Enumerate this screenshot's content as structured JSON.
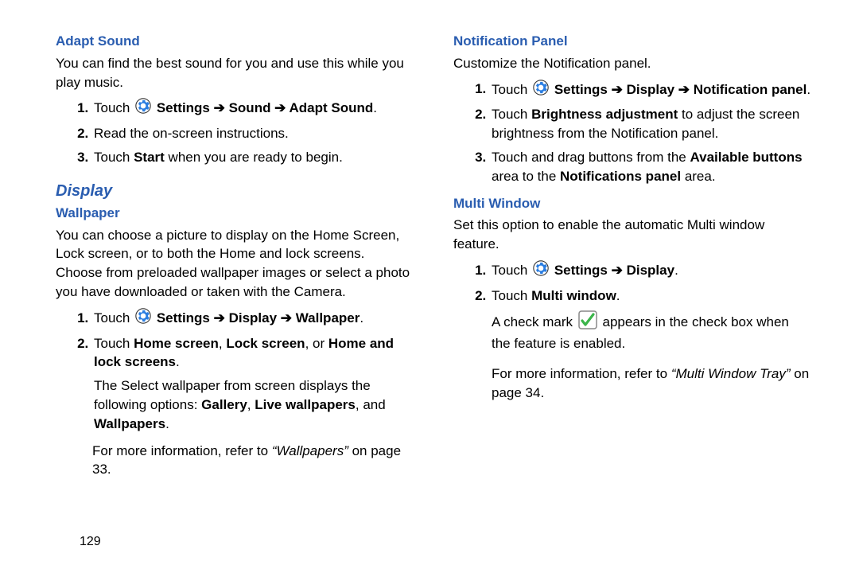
{
  "page_number": "129",
  "left": {
    "adaptSound": {
      "heading": "Adapt Sound",
      "intro": "You can find the best sound for you and use this while you play music.",
      "step1_pre": "Touch ",
      "step1_nav": "Settings ➔ Sound ➔ Adapt Sound",
      "step2": "Read the on-screen instructions.",
      "step3_pre": "Touch ",
      "step3_bold": "Start",
      "step3_post": " when you are ready to begin."
    },
    "displayHeading": "Display",
    "wallpaper": {
      "heading": "Wallpaper",
      "intro": "You can choose a picture to display on the Home Screen, Lock screen, or to both the Home and lock screens. Choose from preloaded wallpaper images or select a photo you have downloaded or taken with the Camera.",
      "step1_pre": "Touch ",
      "step1_nav": "Settings ➔ Display ➔ Wallpaper",
      "step2_pre": "Touch ",
      "step2_b1": "Home screen",
      "step2_m1": ", ",
      "step2_b2": "Lock screen",
      "step2_m2": ", or ",
      "step2_b3": "Home and lock screens",
      "step2_post": ".",
      "step2_follow_pre": "The Select wallpaper from screen displays the following options: ",
      "step2_opt1": "Gallery",
      "step2_comma1": ", ",
      "step2_opt2": "Live wallpapers",
      "step2_comma2": ", and ",
      "step2_opt3": "Wallpapers",
      "step2_follow_post": ".",
      "moreinfo_pre": "For more information, refer to ",
      "moreinfo_ref": "“Wallpapers”",
      "moreinfo_post": " on page 33."
    }
  },
  "right": {
    "notifPanel": {
      "heading": "Notification Panel",
      "intro": "Customize the Notification panel.",
      "step1_pre": "Touch ",
      "step1_nav": "Settings ➔ Display ➔ Notification panel",
      "step2_pre": "Touch ",
      "step2_bold": "Brightness adjustment",
      "step2_post": " to adjust the screen brightness from the Notification panel.",
      "step3_pre": "Touch and drag buttons from the ",
      "step3_b1": "Available buttons",
      "step3_mid": " area to the ",
      "step3_b2": "Notifications panel",
      "step3_post": " area."
    },
    "multiWindow": {
      "heading": "Multi Window",
      "intro": "Set this option to enable the automatic Multi window feature.",
      "step1_pre": "Touch ",
      "step1_nav": "Settings ➔ Display",
      "step2_pre": "Touch ",
      "step2_bold": "Multi window",
      "step2_post": ".",
      "check_pre": "A check mark ",
      "check_post": " appears in the check box when the feature is enabled.",
      "moreinfo_pre": "For more information, refer to ",
      "moreinfo_ref": "“Multi Window Tray”",
      "moreinfo_post": " on page 34."
    }
  }
}
